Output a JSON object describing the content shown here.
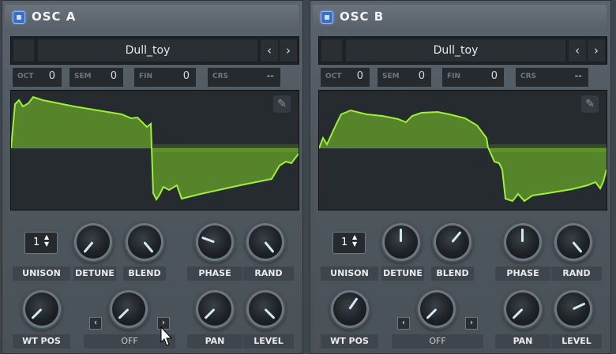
{
  "oscillators": [
    {
      "id": "a",
      "title": "OSC A",
      "preset": "Dull_toy",
      "nav_prev": "‹",
      "nav_next": "›",
      "tune": [
        {
          "label": "OCT",
          "value": "0"
        },
        {
          "label": "SEM",
          "value": "0"
        },
        {
          "label": "FIN",
          "value": "0"
        },
        {
          "label": "CRS",
          "value": "--"
        }
      ],
      "unison_value": "1",
      "labels": {
        "unison": "UNISON",
        "detune": "DETUNE",
        "blend": "BLEND",
        "phase": "PHASE",
        "rand": "RAND",
        "wtpos": "WT POS",
        "off": "OFF",
        "pan": "PAN",
        "level": "LEVEL"
      }
    },
    {
      "id": "b",
      "title": "OSC B",
      "preset": "Dull_toy",
      "nav_prev": "‹",
      "nav_next": "›",
      "tune": [
        {
          "label": "OCT",
          "value": "0"
        },
        {
          "label": "SEM",
          "value": "0"
        },
        {
          "label": "FIN",
          "value": "0"
        },
        {
          "label": "CRS",
          "value": "--"
        }
      ],
      "unison_value": "1",
      "labels": {
        "unison": "UNISON",
        "detune": "DETUNE",
        "blend": "BLEND",
        "phase": "PHASE",
        "rand": "RAND",
        "wtpos": "WT POS",
        "off": "OFF",
        "pan": "PAN",
        "level": "LEVEL"
      }
    }
  ],
  "colors": {
    "accent": "#7fd12a",
    "power": "#3b6ec9",
    "knob_indicator": "#cfeaf5"
  },
  "icons": {
    "power": "power-button-icon",
    "pencil": "pencil-icon",
    "cursor": "mouse-cursor-icon"
  }
}
